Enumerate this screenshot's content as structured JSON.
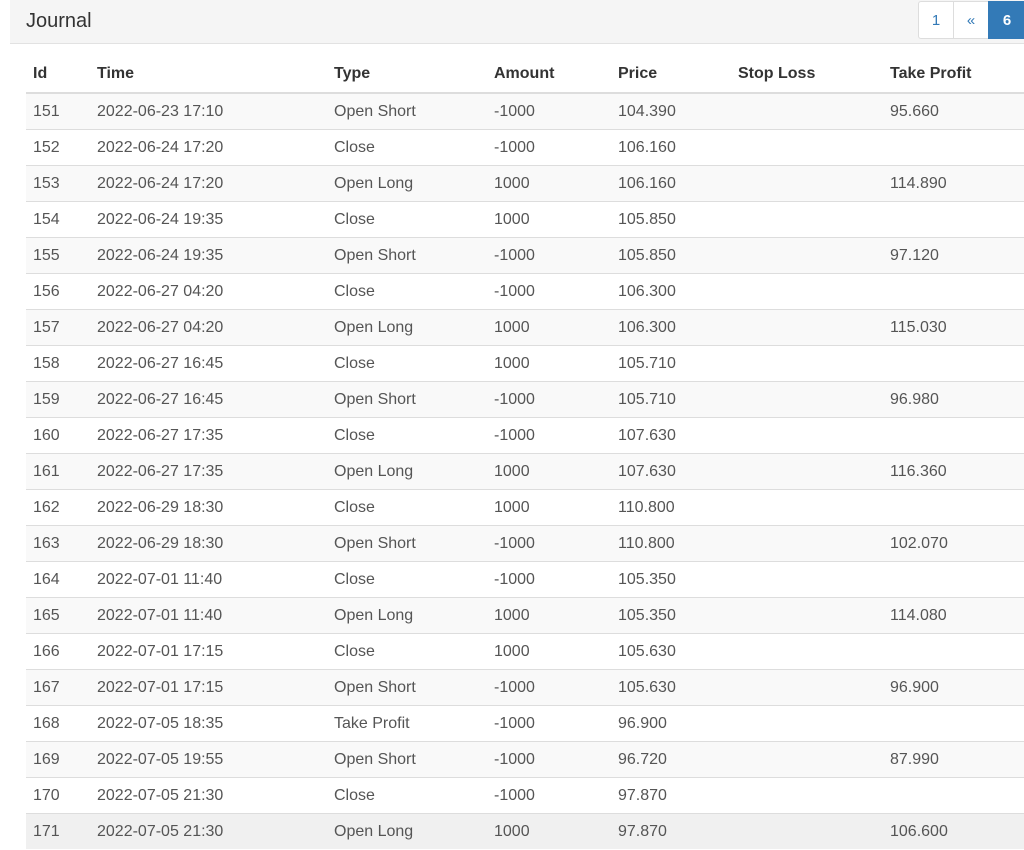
{
  "panel": {
    "title": "Journal"
  },
  "pagination": {
    "pages": [
      "1",
      "«",
      "6"
    ],
    "active_index": 2
  },
  "table": {
    "columns": [
      "Id",
      "Time",
      "Type",
      "Amount",
      "Price",
      "Stop Loss",
      "Take Profit"
    ],
    "rows": [
      [
        "151",
        "2022-06-23 17:10",
        "Open Short",
        "-1000",
        "104.390",
        "",
        "95.660"
      ],
      [
        "152",
        "2022-06-24 17:20",
        "Close",
        "-1000",
        "106.160",
        "",
        ""
      ],
      [
        "153",
        "2022-06-24 17:20",
        "Open Long",
        "1000",
        "106.160",
        "",
        "114.890"
      ],
      [
        "154",
        "2022-06-24 19:35",
        "Close",
        "1000",
        "105.850",
        "",
        ""
      ],
      [
        "155",
        "2022-06-24 19:35",
        "Open Short",
        "-1000",
        "105.850",
        "",
        "97.120"
      ],
      [
        "156",
        "2022-06-27 04:20",
        "Close",
        "-1000",
        "106.300",
        "",
        ""
      ],
      [
        "157",
        "2022-06-27 04:20",
        "Open Long",
        "1000",
        "106.300",
        "",
        "115.030"
      ],
      [
        "158",
        "2022-06-27 16:45",
        "Close",
        "1000",
        "105.710",
        "",
        ""
      ],
      [
        "159",
        "2022-06-27 16:45",
        "Open Short",
        "-1000",
        "105.710",
        "",
        "96.980"
      ],
      [
        "160",
        "2022-06-27 17:35",
        "Close",
        "-1000",
        "107.630",
        "",
        ""
      ],
      [
        "161",
        "2022-06-27 17:35",
        "Open Long",
        "1000",
        "107.630",
        "",
        "116.360"
      ],
      [
        "162",
        "2022-06-29 18:30",
        "Close",
        "1000",
        "110.800",
        "",
        ""
      ],
      [
        "163",
        "2022-06-29 18:30",
        "Open Short",
        "-1000",
        "110.800",
        "",
        "102.070"
      ],
      [
        "164",
        "2022-07-01 11:40",
        "Close",
        "-1000",
        "105.350",
        "",
        ""
      ],
      [
        "165",
        "2022-07-01 11:40",
        "Open Long",
        "1000",
        "105.350",
        "",
        "114.080"
      ],
      [
        "166",
        "2022-07-01 17:15",
        "Close",
        "1000",
        "105.630",
        "",
        ""
      ],
      [
        "167",
        "2022-07-01 17:15",
        "Open Short",
        "-1000",
        "105.630",
        "",
        "96.900"
      ],
      [
        "168",
        "2022-07-05 18:35",
        "Take Profit",
        "-1000",
        "96.900",
        "",
        ""
      ],
      [
        "169",
        "2022-07-05 19:55",
        "Open Short",
        "-1000",
        "96.720",
        "",
        "87.990"
      ],
      [
        "170",
        "2022-07-05 21:30",
        "Close",
        "-1000",
        "97.870",
        "",
        ""
      ],
      [
        "171",
        "2022-07-05 21:30",
        "Open Long",
        "1000",
        "97.870",
        "",
        "106.600"
      ]
    ]
  }
}
